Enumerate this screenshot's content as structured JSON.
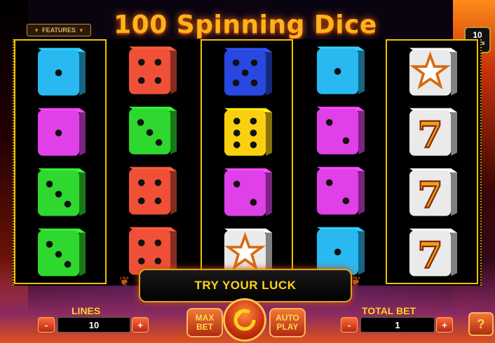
{
  "game": {
    "title": "100 Spinning Dice"
  },
  "features_button": {
    "label": "FEATURES"
  },
  "lines_badge": {
    "number": "10",
    "label": "Lines"
  },
  "message": {
    "text": "TRY YOUR LUCK"
  },
  "lines": {
    "label": "LINES",
    "value": "10",
    "minus": "-",
    "plus": "+"
  },
  "max_bet": {
    "label_line1": "MAX",
    "label_line2": "BET"
  },
  "auto_play": {
    "label_line1": "AUTO",
    "label_line2": "PLAY"
  },
  "total_bet": {
    "label": "TOTAL BET",
    "value": "1",
    "minus": "-",
    "plus": "+"
  },
  "help": {
    "label": "?"
  },
  "colors": {
    "cyan": "#29b8f0",
    "magenta": "#e040e8",
    "green": "#2ed82e",
    "red": "#f05038",
    "blue": "#2848e0",
    "yellow": "#f8d010",
    "white": "#eaeaea",
    "gold": "#f2c200"
  },
  "reels": [
    {
      "highlighted": true,
      "symbols": [
        {
          "type": "die",
          "color": "cyan",
          "pips": 1
        },
        {
          "type": "die",
          "color": "magenta",
          "pips": 1
        },
        {
          "type": "die",
          "color": "green",
          "pips": 3
        },
        {
          "type": "die",
          "color": "green",
          "pips": 3
        }
      ]
    },
    {
      "highlighted": false,
      "symbols": [
        {
          "type": "die",
          "color": "red",
          "pips": 4
        },
        {
          "type": "die",
          "color": "green",
          "pips": 3
        },
        {
          "type": "die",
          "color": "red",
          "pips": 4
        },
        {
          "type": "die",
          "color": "red",
          "pips": 4
        }
      ]
    },
    {
      "highlighted": true,
      "symbols": [
        {
          "type": "die",
          "color": "blue",
          "pips": 5
        },
        {
          "type": "die",
          "color": "yellow",
          "pips": 6
        },
        {
          "type": "die",
          "color": "magenta",
          "pips": 2
        },
        {
          "type": "star",
          "color": "white"
        }
      ]
    },
    {
      "highlighted": false,
      "symbols": [
        {
          "type": "die",
          "color": "cyan",
          "pips": 1
        },
        {
          "type": "die",
          "color": "magenta",
          "pips": 2
        },
        {
          "type": "die",
          "color": "magenta",
          "pips": 2
        },
        {
          "type": "die",
          "color": "cyan",
          "pips": 1
        }
      ]
    },
    {
      "highlighted": true,
      "symbols": [
        {
          "type": "star",
          "color": "white"
        },
        {
          "type": "seven",
          "color": "white"
        },
        {
          "type": "seven",
          "color": "white"
        },
        {
          "type": "seven",
          "color": "white"
        }
      ]
    }
  ]
}
